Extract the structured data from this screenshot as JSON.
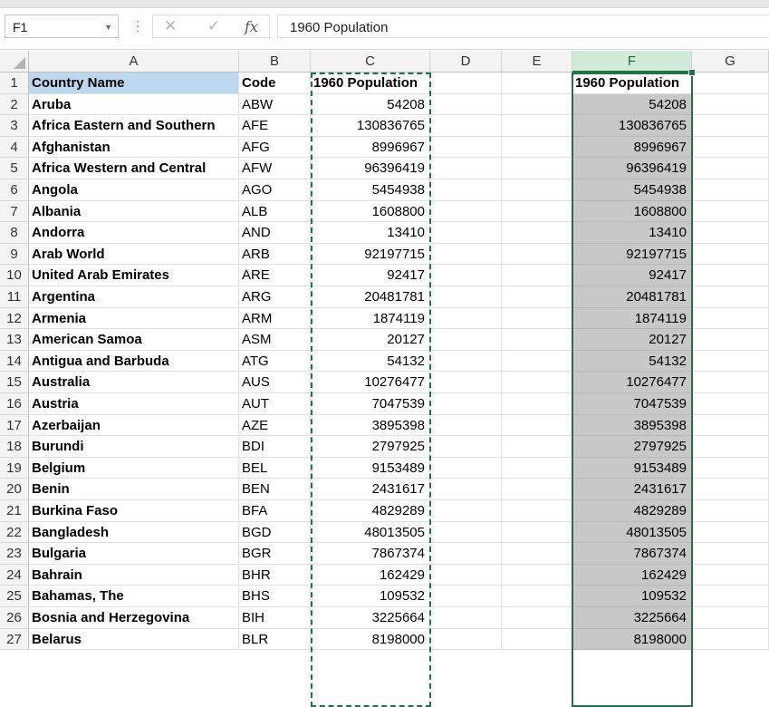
{
  "formula_bar": {
    "name_box": "F1",
    "formula": "1960 Population",
    "fx_label": "fx",
    "cancel_glyph": "✕",
    "enter_glyph": "✓"
  },
  "columns": [
    "A",
    "B",
    "C",
    "D",
    "E",
    "F",
    "G"
  ],
  "selected_column": "F",
  "header_row": {
    "country": "Country Name",
    "code": "Code",
    "pop": "1960 Population",
    "pop_copy": "1960 Population"
  },
  "rows": [
    {
      "n": "2",
      "country": "Aruba",
      "code": "ABW",
      "pop": "54208"
    },
    {
      "n": "3",
      "country": "Africa Eastern and Southern",
      "code": "AFE",
      "pop": "130836765"
    },
    {
      "n": "4",
      "country": "Afghanistan",
      "code": "AFG",
      "pop": "8996967"
    },
    {
      "n": "5",
      "country": "Africa Western and Central",
      "code": "AFW",
      "pop": "96396419"
    },
    {
      "n": "6",
      "country": "Angola",
      "code": "AGO",
      "pop": "5454938"
    },
    {
      "n": "7",
      "country": "Albania",
      "code": "ALB",
      "pop": "1608800"
    },
    {
      "n": "8",
      "country": "Andorra",
      "code": "AND",
      "pop": "13410"
    },
    {
      "n": "9",
      "country": "Arab World",
      "code": "ARB",
      "pop": "92197715"
    },
    {
      "n": "10",
      "country": "United Arab Emirates",
      "code": "ARE",
      "pop": "92417"
    },
    {
      "n": "11",
      "country": "Argentina",
      "code": "ARG",
      "pop": "20481781"
    },
    {
      "n": "12",
      "country": "Armenia",
      "code": "ARM",
      "pop": "1874119"
    },
    {
      "n": "13",
      "country": "American Samoa",
      "code": "ASM",
      "pop": "20127"
    },
    {
      "n": "14",
      "country": "Antigua and Barbuda",
      "code": "ATG",
      "pop": "54132"
    },
    {
      "n": "15",
      "country": "Australia",
      "code": "AUS",
      "pop": "10276477"
    },
    {
      "n": "16",
      "country": "Austria",
      "code": "AUT",
      "pop": "7047539"
    },
    {
      "n": "17",
      "country": "Azerbaijan",
      "code": "AZE",
      "pop": "3895398"
    },
    {
      "n": "18",
      "country": "Burundi",
      "code": "BDI",
      "pop": "2797925"
    },
    {
      "n": "19",
      "country": "Belgium",
      "code": "BEL",
      "pop": "9153489"
    },
    {
      "n": "20",
      "country": "Benin",
      "code": "BEN",
      "pop": "2431617"
    },
    {
      "n": "21",
      "country": "Burkina Faso",
      "code": "BFA",
      "pop": "4829289"
    },
    {
      "n": "22",
      "country": "Bangladesh",
      "code": "BGD",
      "pop": "48013505"
    },
    {
      "n": "23",
      "country": "Bulgaria",
      "code": "BGR",
      "pop": "7867374"
    },
    {
      "n": "24",
      "country": "Bahrain",
      "code": "BHR",
      "pop": "162429"
    },
    {
      "n": "25",
      "country": "Bahamas, The",
      "code": "BHS",
      "pop": "109532"
    },
    {
      "n": "26",
      "country": "Bosnia and Herzegovina",
      "code": "BIH",
      "pop": "3225664"
    },
    {
      "n": "27",
      "country": "Belarus",
      "code": "BLR",
      "pop": "8198000"
    }
  ],
  "colors": {
    "accent": "#217346",
    "header_fill": "#bdd7ee",
    "selection_fill": "#c8c8c8"
  }
}
